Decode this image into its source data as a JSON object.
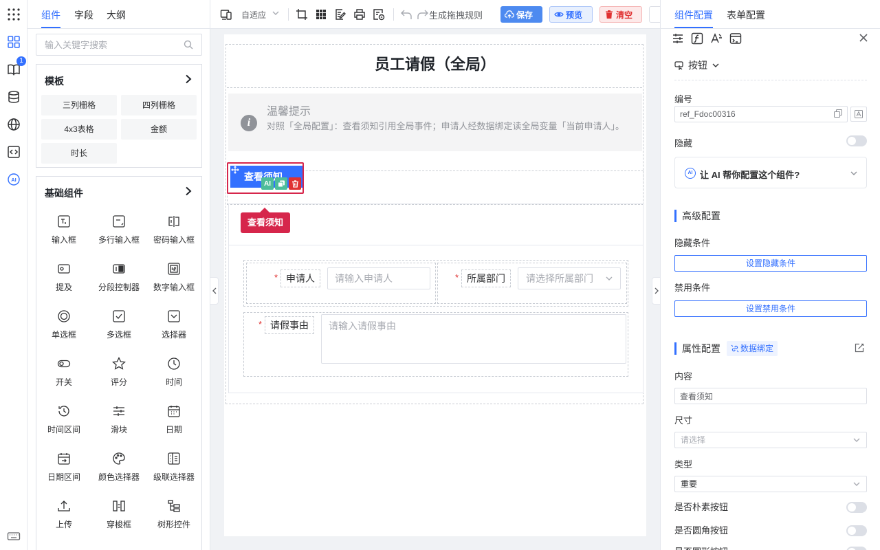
{
  "colors": {
    "accent": "#3370ff",
    "danger": "#e03131",
    "selection": "#d6264b",
    "success": "#4dbd9a"
  },
  "rail": {
    "items": [
      {
        "icon": "grid-menu-icon"
      },
      {
        "icon": "components-icon"
      },
      {
        "icon": "book-icon",
        "badge": "1"
      },
      {
        "icon": "database-icon"
      },
      {
        "icon": "globe-icon"
      },
      {
        "icon": "code-icon"
      },
      {
        "icon": "ai-icon",
        "label": "AI"
      },
      {
        "icon": "keyboard-icon"
      }
    ]
  },
  "left_panel": {
    "tabs": [
      "组件",
      "字段",
      "大纲"
    ],
    "active_tab": "组件",
    "search_placeholder": "输入关键字搜索",
    "templates": {
      "title": "模板",
      "items": [
        "三列栅格",
        "四列栅格",
        "4x3表格",
        "金额",
        "时长"
      ]
    },
    "basic": {
      "title": "基础组件",
      "items": [
        {
          "label": "输入框",
          "icon": "text-input-icon"
        },
        {
          "label": "多行输入框",
          "icon": "textarea-icon"
        },
        {
          "label": "密码输入框",
          "icon": "password-icon"
        },
        {
          "label": "提及",
          "icon": "mention-icon"
        },
        {
          "label": "分段控制器",
          "icon": "segmented-icon"
        },
        {
          "label": "数字输入框",
          "icon": "number-input-icon"
        },
        {
          "label": "单选框",
          "icon": "radio-icon"
        },
        {
          "label": "多选框",
          "icon": "checkbox-icon"
        },
        {
          "label": "选择器",
          "icon": "select-icon"
        },
        {
          "label": "开关",
          "icon": "switch-icon"
        },
        {
          "label": "评分",
          "icon": "star-icon"
        },
        {
          "label": "时间",
          "icon": "clock-icon"
        },
        {
          "label": "时间区间",
          "icon": "time-range-icon"
        },
        {
          "label": "滑块",
          "icon": "slider-icon"
        },
        {
          "label": "日期",
          "icon": "calendar-icon"
        },
        {
          "label": "日期区间",
          "icon": "date-range-icon"
        },
        {
          "label": "颜色选择器",
          "icon": "palette-icon"
        },
        {
          "label": "级联选择器",
          "icon": "cascader-icon"
        },
        {
          "label": "上传",
          "icon": "upload-icon"
        },
        {
          "label": "穿梭框",
          "icon": "transfer-icon"
        },
        {
          "label": "树形控件",
          "icon": "tree-icon"
        }
      ]
    }
  },
  "toolbar": {
    "layout_mode": "自适应",
    "rule_label": "生成拖拽规则",
    "save": "保存",
    "preview": "预览",
    "clear": "清空"
  },
  "canvas": {
    "form_title": "员工请假（全局）",
    "tip": {
      "title": "温馨提示",
      "body": "对照「全局配置」：查看须知引用全局事件；申请人经数据绑定读全局变量「当前申请人」。"
    },
    "selected_button": {
      "label": "查看须知",
      "tools": [
        "AI",
        "copy",
        "delete"
      ]
    },
    "selected_tag": "查看须知",
    "fields": {
      "applicant": {
        "label": "申请人",
        "placeholder": "请输入申请人",
        "required": "*"
      },
      "department": {
        "label": "所属部门",
        "placeholder": "请选择所属部门",
        "required": "*"
      },
      "reason": {
        "label": "请假事由",
        "placeholder": "请输入请假事由",
        "required": "*"
      }
    }
  },
  "right_panel": {
    "tabs": [
      "组件配置",
      "表单配置"
    ],
    "active_tab": "组件配置",
    "component_type": "按钮",
    "id_label": "编号",
    "id_value": "ref_Fdoc00316",
    "hidden_label": "隐藏",
    "ai_prompt": "让 AI 帮你配置这个组件?",
    "advanced": {
      "title": "高级配置",
      "hide_condition_label": "隐藏条件",
      "hide_condition_button": "设置隐藏条件",
      "disable_condition_label": "禁用条件",
      "disable_condition_button": "设置禁用条件"
    },
    "props": {
      "title": "属性配置",
      "binding_chip": "数据绑定",
      "content_label": "内容",
      "content_value": "查看须知",
      "size_label": "尺寸",
      "size_placeholder": "请选择",
      "type_label": "类型",
      "type_value": "重要",
      "plain_label": "是否朴素按钮",
      "round_label": "是否圆角按钮",
      "circle_label": "是否圆形按钮"
    }
  }
}
